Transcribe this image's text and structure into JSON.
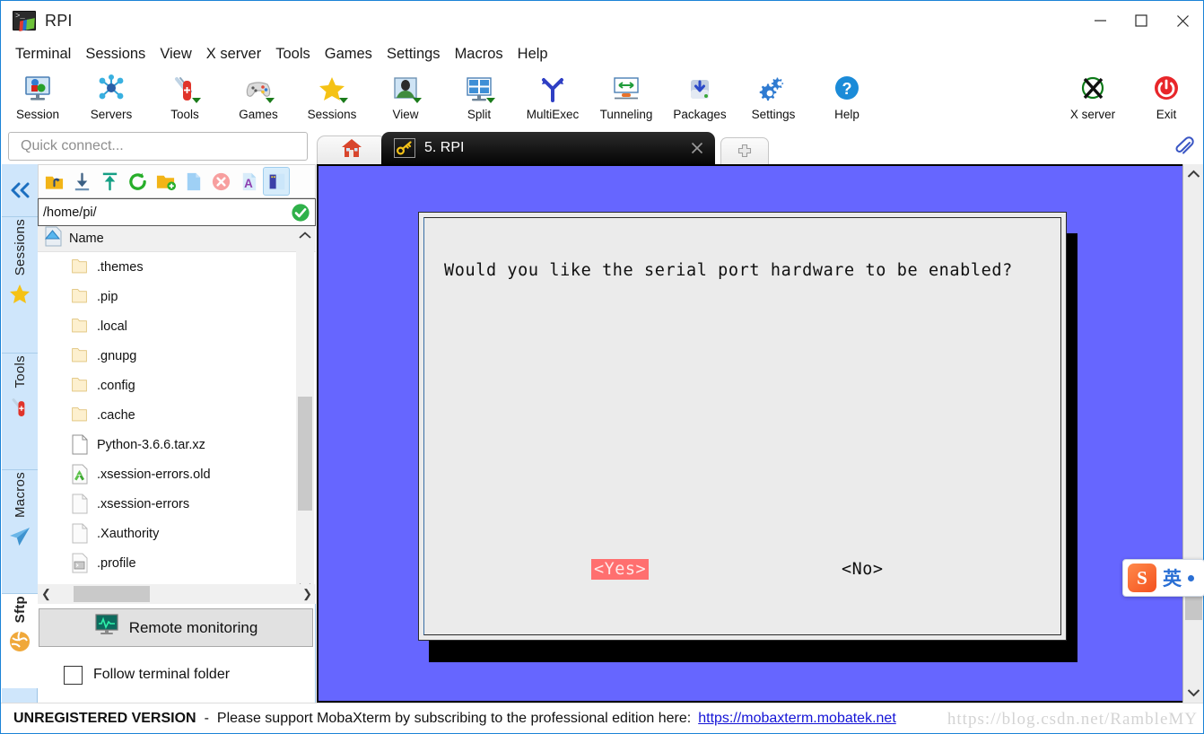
{
  "window": {
    "title": "RPI",
    "app_icon": "terminal-rgb-icon",
    "controls": {
      "minimize": "minimize-icon",
      "maximize": "maximize-icon",
      "close": "close-icon"
    }
  },
  "menubar": {
    "items": [
      {
        "label": "Terminal"
      },
      {
        "label": "Sessions"
      },
      {
        "label": "View"
      },
      {
        "label": "X server"
      },
      {
        "label": "Tools"
      },
      {
        "label": "Games"
      },
      {
        "label": "Settings"
      },
      {
        "label": "Macros"
      },
      {
        "label": "Help"
      }
    ]
  },
  "toolbar": {
    "items": [
      {
        "label": "Session",
        "icon": "session-monitor-icon",
        "dropdown": false
      },
      {
        "label": "Servers",
        "icon": "servers-network-icon",
        "dropdown": false
      },
      {
        "label": "Tools",
        "icon": "swiss-knife-icon",
        "dropdown": true
      },
      {
        "label": "Games",
        "icon": "gamepad-icon",
        "dropdown": true
      },
      {
        "label": "Sessions",
        "icon": "star-icon",
        "dropdown": true
      },
      {
        "label": "View",
        "icon": "view-person-icon",
        "dropdown": true
      },
      {
        "label": "Split",
        "icon": "split-grid-icon",
        "dropdown": true
      },
      {
        "label": "MultiExec",
        "icon": "multiexec-fork-icon",
        "dropdown": false
      },
      {
        "label": "Tunneling",
        "icon": "tunneling-icon",
        "dropdown": false
      },
      {
        "label": "Packages",
        "icon": "package-download-icon",
        "dropdown": false
      },
      {
        "label": "Settings",
        "icon": "gears-icon",
        "dropdown": false
      },
      {
        "label": "Help",
        "icon": "help-question-icon",
        "dropdown": false
      }
    ],
    "right_items": [
      {
        "label": "X server",
        "icon": "x-server-icon"
      },
      {
        "label": "Exit",
        "icon": "power-exit-icon"
      }
    ]
  },
  "quick_connect": {
    "placeholder": "Quick connect..."
  },
  "rail": {
    "collapse_icon": "double-chevron-left-icon",
    "groups": [
      {
        "label": "Sessions",
        "icon": "star-icon",
        "active": false
      },
      {
        "label": "Tools",
        "icon": "swiss-knife-icon",
        "active": false
      },
      {
        "label": "Macros",
        "icon": "paper-plane-icon",
        "active": false
      },
      {
        "label": "Sftp",
        "icon": "globe-icon",
        "active": true
      }
    ]
  },
  "sftp": {
    "toolbar_buttons": [
      {
        "name": "go-up-folder-icon",
        "selected": false
      },
      {
        "name": "download-icon",
        "selected": false
      },
      {
        "name": "upload-icon",
        "selected": false
      },
      {
        "name": "refresh-icon",
        "selected": false
      },
      {
        "name": "new-folder-icon",
        "selected": false
      },
      {
        "name": "new-file-icon",
        "selected": false
      },
      {
        "name": "delete-icon",
        "selected": false
      },
      {
        "name": "text-edit-icon",
        "selected": false
      },
      {
        "name": "toggle-panel-icon",
        "selected": true
      }
    ],
    "path": "/home/pi/",
    "path_confirm_icon": "green-check-icon",
    "column_header": "Name",
    "sort_icon": "sort-ascending-icon",
    "files": [
      {
        "name": ".themes",
        "type": "folder"
      },
      {
        "name": ".pip",
        "type": "folder"
      },
      {
        "name": ".local",
        "type": "folder"
      },
      {
        "name": ".gnupg",
        "type": "folder"
      },
      {
        "name": ".config",
        "type": "folder"
      },
      {
        "name": ".cache",
        "type": "folder"
      },
      {
        "name": "Python-3.6.6.tar.xz",
        "type": "file"
      },
      {
        "name": ".xsession-errors.old",
        "type": "recycle"
      },
      {
        "name": ".xsession-errors",
        "type": "file"
      },
      {
        "name": ".Xauthority",
        "type": "file"
      },
      {
        "name": ".profile",
        "type": "script"
      }
    ],
    "remote_monitoring": {
      "label": "Remote monitoring",
      "icon": "monitor-graph-icon"
    },
    "follow_terminal_folder": {
      "label": "Follow terminal folder",
      "checked": false
    }
  },
  "tabs": {
    "home_icon": "home-icon",
    "active": {
      "label": "5. RPI",
      "icon": "yellow-key-icon",
      "close_icon": "close-icon"
    },
    "new_tab_icon": "plus-icon",
    "clip_icon": "paperclip-icon"
  },
  "terminal": {
    "background_color": "#6666ff",
    "frame_color": "#000000",
    "dialog": {
      "background_color": "#ebebeb",
      "question": "Would you like the serial port hardware to be enabled?",
      "buttons": [
        {
          "label": "<Yes>",
          "selected": true,
          "bg": "#ff6f6f",
          "fg": "#ffe9e9"
        },
        {
          "label": "<No>",
          "selected": false,
          "bg": "transparent",
          "fg": "#101010"
        }
      ]
    },
    "scrollbar": {
      "up_icon": "chevron-up-icon",
      "down_icon": "chevron-down-icon"
    }
  },
  "ime": {
    "logo": "sogou-logo-icon",
    "mode": "英",
    "dot": "round-dot-icon"
  },
  "statusbar": {
    "unregistered": "UNREGISTERED VERSION",
    "dash": "-",
    "message": "Please support MobaXterm by subscribing to the professional edition here:",
    "link": "https://mobaxterm.mobatek.net"
  },
  "watermark": "https://blog.csdn.net/RambleMY"
}
